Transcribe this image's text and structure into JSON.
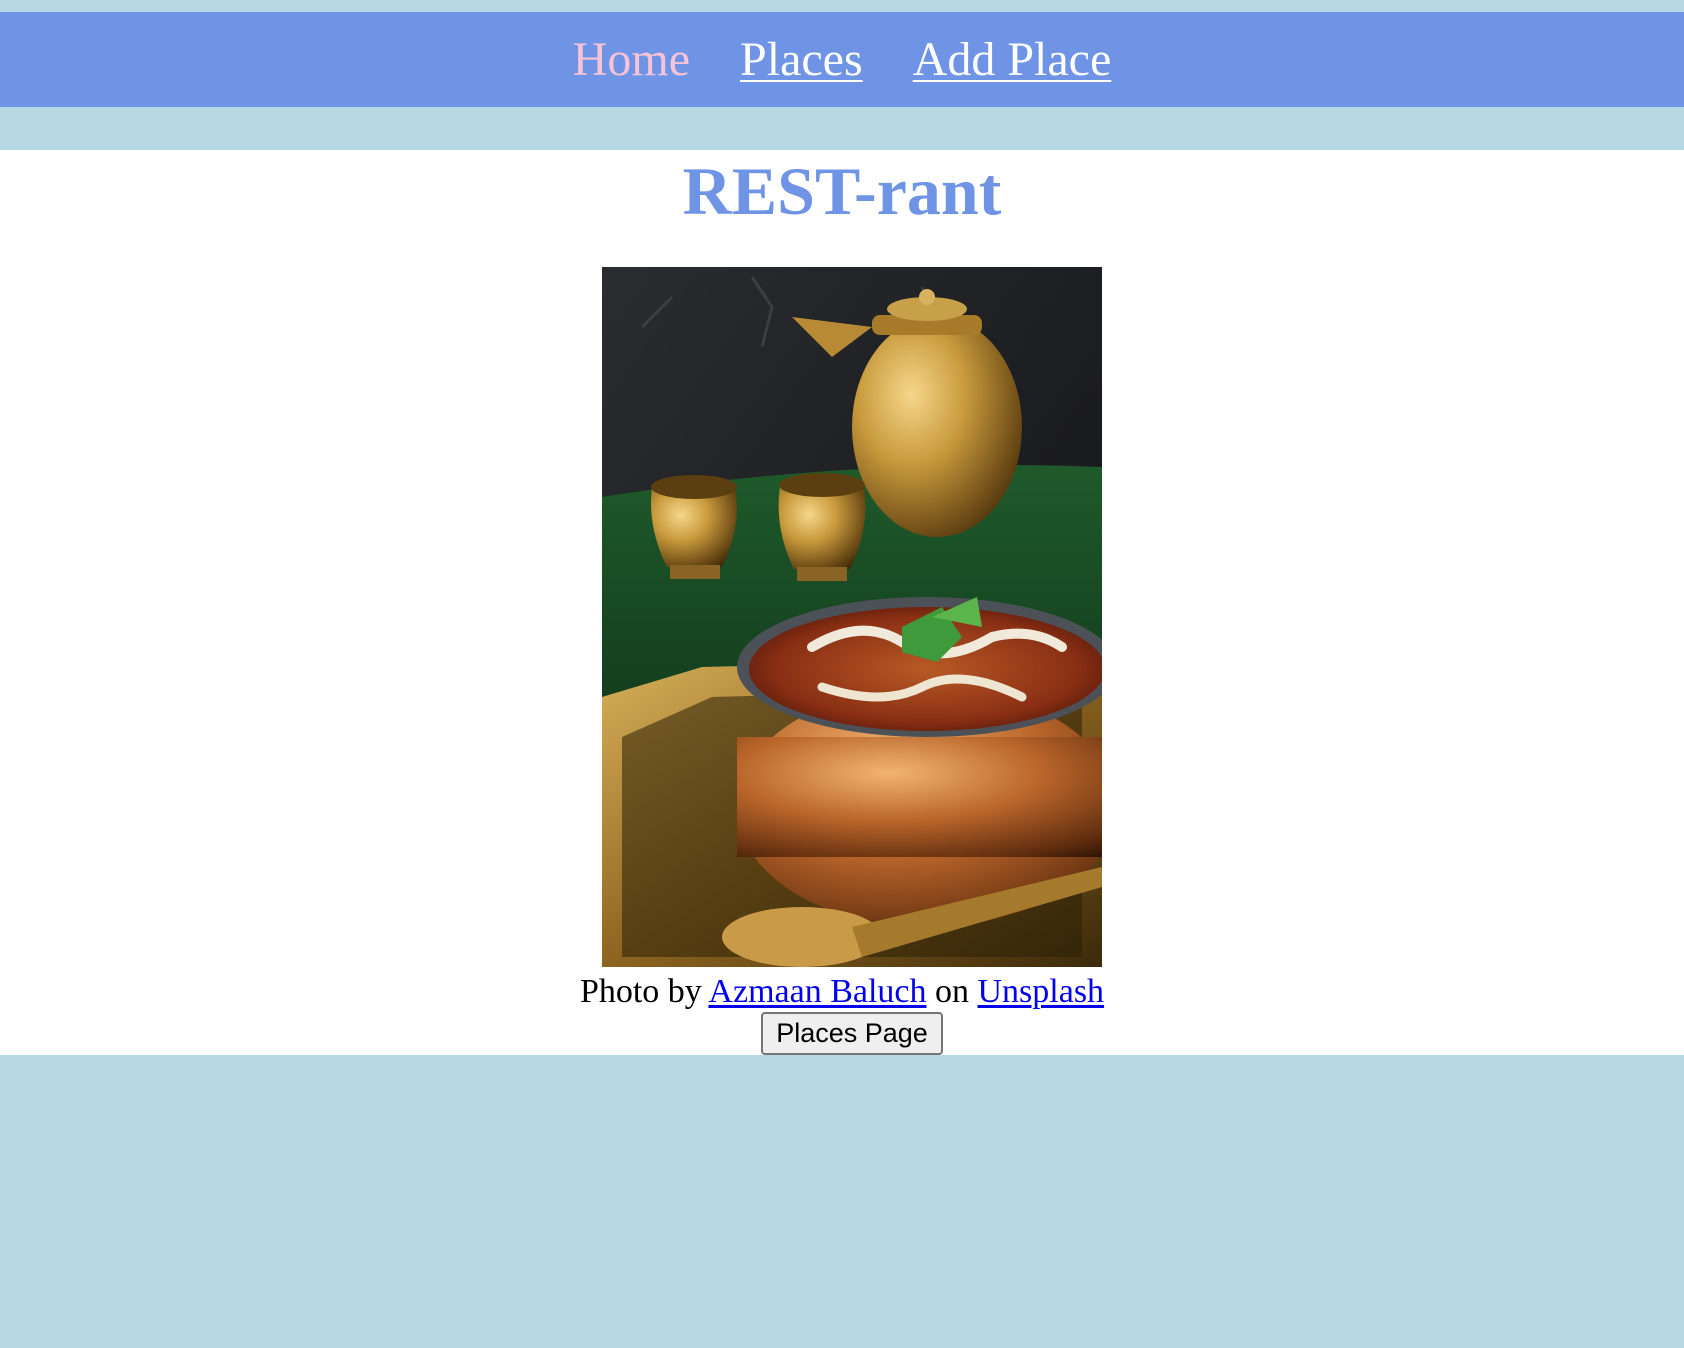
{
  "nav": {
    "items": [
      {
        "label": "Home",
        "active": true
      },
      {
        "label": "Places",
        "active": false
      },
      {
        "label": "Add Place",
        "active": false
      }
    ]
  },
  "main": {
    "title": "REST-rant",
    "image": {
      "icon": "food-photo",
      "alt": "curry in a brass bowl with brass pitcher and cups"
    },
    "caption": {
      "prefix": "Photo by",
      "author": "Azmaan Baluch",
      "middle": "on",
      "site": "Unsplash"
    },
    "button_label": "Places Page"
  },
  "colors": {
    "page_bg": "#b6d8e3",
    "nav_bg": "#6f94e5",
    "title": "#6f94e5",
    "active_link": "#f6c4d6",
    "link": "#0000ee"
  }
}
